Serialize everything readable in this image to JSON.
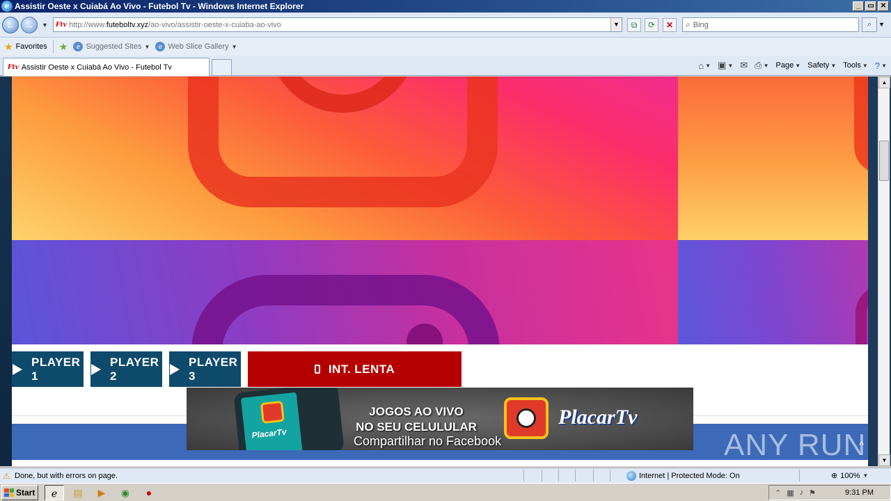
{
  "window": {
    "title": "Assistir Oeste x Cuiabá Ao Vivo - Futebol Tv - Windows Internet Explorer",
    "buttons": {
      "minimize": "_",
      "maximize": "▭",
      "close": "✕"
    }
  },
  "nav": {
    "back_icon": "back-arrow-icon",
    "forward_icon": "forward-arrow-icon",
    "favicon": "Ftv",
    "url_prefix": "http://www.",
    "url_domain": "futeboltv.xyz",
    "url_path": "/ao-vivo/assistir-oeste-x-cuiaba-ao-vivo",
    "search_placeholder": "Bing"
  },
  "favorites": {
    "label": "Favorites",
    "links": [
      {
        "label": "Suggested Sites"
      },
      {
        "label": "Web Slice Gallery"
      }
    ]
  },
  "tabs": [
    {
      "favicon": "Ftv",
      "label": "Assistir Oeste x Cuiabá Ao Vivo - Futebol Tv",
      "active": true
    }
  ],
  "commandbar": {
    "page": "Page",
    "safety": "Safety",
    "tools": "Tools"
  },
  "page": {
    "players": [
      {
        "label": "PLAYER 1"
      },
      {
        "label": "PLAYER 2"
      },
      {
        "label": "PLAYER 3"
      }
    ],
    "slow_button": "INT. LENTA",
    "banner": {
      "small_brand": "PlacarTv",
      "headline_line1": "JOGOS AO VIVO",
      "headline_line2": "NO SEU CELULULAR",
      "brand": "PlacarTv",
      "share_text": "Compartilhar no Facebook"
    },
    "scroll_top_icon": "^",
    "watermark": "ANY RUN"
  },
  "statusbar": {
    "message": "Done, but with errors on page.",
    "zone": "Internet | Protected Mode: On",
    "zoom": "100%"
  },
  "taskbar": {
    "start": "Start",
    "clock": "9:31 PM"
  },
  "colors": {
    "player_button": "#0e4a6b",
    "slow_button": "#b50000",
    "footer_bar": "#3c6ab8"
  }
}
